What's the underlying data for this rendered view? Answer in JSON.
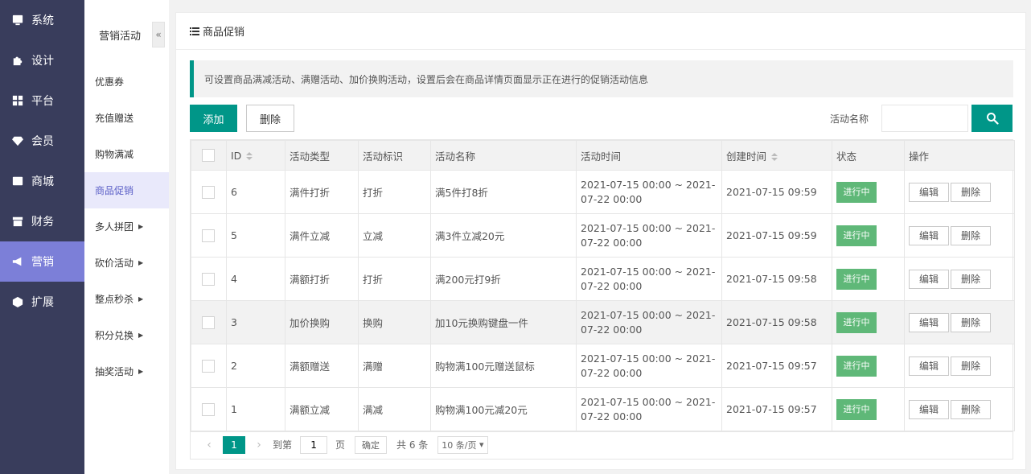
{
  "sidebar": {
    "items": [
      {
        "label": "系统",
        "icon": "system-icon"
      },
      {
        "label": "设计",
        "icon": "puzzle-icon"
      },
      {
        "label": "平台",
        "icon": "grid-icon"
      },
      {
        "label": "会员",
        "icon": "diamond-icon"
      },
      {
        "label": "商城",
        "icon": "mail-icon"
      },
      {
        "label": "财务",
        "icon": "archive-icon"
      },
      {
        "label": "营销",
        "icon": "megaphone-icon"
      },
      {
        "label": "扩展",
        "icon": "cube-icon"
      }
    ],
    "active_index": 6
  },
  "submenu": {
    "title": "营销活动",
    "collapse_glyph": "«",
    "items": [
      {
        "label": "优惠券",
        "has_caret": false
      },
      {
        "label": "充值赠送",
        "has_caret": false
      },
      {
        "label": "购物满减",
        "has_caret": false
      },
      {
        "label": "商品促销",
        "has_caret": false
      },
      {
        "label": "多人拼团",
        "has_caret": true
      },
      {
        "label": "砍价活动",
        "has_caret": true
      },
      {
        "label": "整点秒杀",
        "has_caret": true
      },
      {
        "label": "积分兑换",
        "has_caret": true
      },
      {
        "label": "抽奖活动",
        "has_caret": true
      }
    ],
    "active_index": 3
  },
  "panel": {
    "title": "商品促销",
    "notice": "可设置商品满减活动、满赠活动、加价换购活动，设置后会在商品详情页面显示正在进行的促销活动信息"
  },
  "toolbar": {
    "add_label": "添加",
    "delete_label": "删除",
    "search_label": "活动名称",
    "search_value": "",
    "search_icon": "search-icon"
  },
  "table": {
    "headers": [
      "",
      "ID",
      "活动类型",
      "活动标识",
      "活动名称",
      "活动时间",
      "创建时间",
      "状态",
      "操作"
    ],
    "rows": [
      {
        "id": "6",
        "type": "满件打折",
        "tag": "打折",
        "name": "满5件打8折",
        "time": "2021-07-15 00:00 ~ 2021-07-22 00:00",
        "created": "2021-07-15 09:59",
        "status": "进行中"
      },
      {
        "id": "5",
        "type": "满件立减",
        "tag": "立减",
        "name": "满3件立减20元",
        "time": "2021-07-15 00:00 ~ 2021-07-22 00:00",
        "created": "2021-07-15 09:59",
        "status": "进行中"
      },
      {
        "id": "4",
        "type": "满额打折",
        "tag": "打折",
        "name": "满200元打9折",
        "time": "2021-07-15 00:00 ~ 2021-07-22 00:00",
        "created": "2021-07-15 09:58",
        "status": "进行中"
      },
      {
        "id": "3",
        "type": "加价换购",
        "tag": "换购",
        "name": "加10元换购键盘一件",
        "time": "2021-07-15 00:00 ~ 2021-07-22 00:00",
        "created": "2021-07-15 09:58",
        "status": "进行中"
      },
      {
        "id": "2",
        "type": "满额赠送",
        "tag": "满赠",
        "name": "购物满100元赠送鼠标",
        "time": "2021-07-15 00:00 ~ 2021-07-22 00:00",
        "created": "2021-07-15 09:57",
        "status": "进行中"
      },
      {
        "id": "1",
        "type": "满额立减",
        "tag": "满减",
        "name": "购物满100元减20元",
        "time": "2021-07-15 00:00 ~ 2021-07-22 00:00",
        "created": "2021-07-15 09:57",
        "status": "进行中"
      }
    ],
    "hover_row_index": 3,
    "edit_label": "编辑",
    "delete_label": "删除"
  },
  "pager": {
    "prev": "‹",
    "next": "›",
    "current_page": "1",
    "goto_label": "到第",
    "page_input": "1",
    "page_unit": "页",
    "confirm_label": "确定",
    "total_label": "共 6 条",
    "page_size": "10 条/页"
  },
  "colors": {
    "sidebar_bg": "#393d5c",
    "sidebar_active": "#7c7fd8",
    "primary": "#009688",
    "status_green": "#5fb878"
  }
}
